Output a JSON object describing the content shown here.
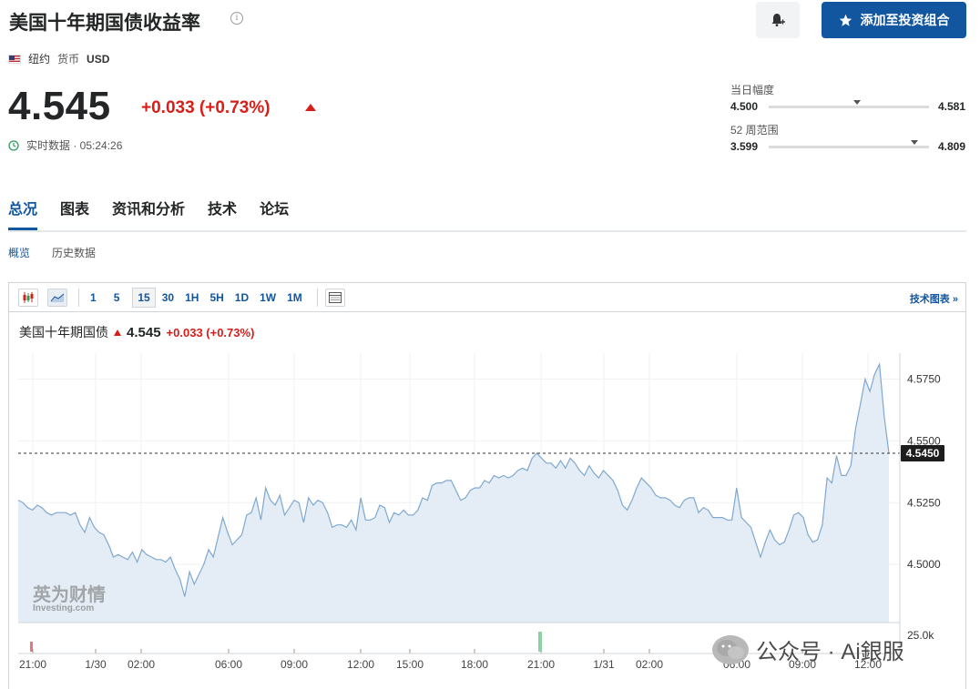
{
  "header": {
    "title": "美国十年期国债收益率",
    "info_icon": "info-icon",
    "add_button_label": "添加至投资组合",
    "bell_icon": "bell-plus-icon"
  },
  "meta": {
    "location": "纽约",
    "currency_label": "货币",
    "currency": "USD"
  },
  "quote": {
    "price": "4.545",
    "change": "+0.033 (+0.73%)",
    "status": "实时数据 · 05:24:26"
  },
  "ranges": {
    "day": {
      "label": "当日幅度",
      "low": "4.500",
      "high": "4.581",
      "marker": 0.55
    },
    "week52": {
      "label": "52 周范围",
      "low": "3.599",
      "high": "4.809",
      "marker": 0.91
    }
  },
  "tabs": [
    "总况",
    "图表",
    "资讯和分析",
    "技术",
    "论坛"
  ],
  "subtabs": [
    "概览",
    "历史数据"
  ],
  "toolbar": {
    "intervals": [
      "1",
      "5",
      "15",
      "30",
      "1H",
      "5H",
      "1D",
      "1W",
      "1M"
    ],
    "active_interval": "15",
    "tech_chart_label": "技术图表 »"
  },
  "legend": {
    "name": "美国十年期国债",
    "value": "4.545",
    "change": "+0.033 (+0.73%)"
  },
  "watermark": {
    "logo_cn": "英为财情",
    "logo_en": "Investing.com",
    "overlay": "公众号 · Ai銀服"
  },
  "colors": {
    "accent": "#1256a0",
    "down_red": "#d91e18",
    "line": "#7fa8cf",
    "area": "#e4edf5"
  },
  "chart_data": {
    "type": "area",
    "x_tick_labels": [
      "21:00",
      "1/30",
      "02:00",
      "06:00",
      "09:00",
      "12:00",
      "15:00",
      "18:00",
      "21:00",
      "1/31",
      "02:00",
      "06:00",
      "09:00",
      "12:00"
    ],
    "y_tick_labels": [
      "4.5750",
      "4.5500",
      "4.5250",
      "4.5000"
    ],
    "volume_label": "25.0k",
    "current_label": "4.5450",
    "current_value": 4.545,
    "ylim": [
      4.4765,
      4.5855
    ],
    "grid": true,
    "values": [
      4.526,
      4.525,
      4.523,
      4.522,
      4.524,
      4.523,
      4.521,
      4.52,
      4.521,
      4.521,
      4.521,
      4.52,
      4.521,
      4.516,
      4.513,
      4.519,
      4.515,
      4.513,
      4.512,
      4.508,
      4.503,
      4.504,
      4.503,
      4.502,
      4.505,
      4.501,
      4.506,
      4.504,
      4.503,
      4.502,
      4.502,
      4.501,
      4.503,
      4.498,
      4.494,
      4.487,
      4.497,
      4.492,
      4.496,
      4.5,
      4.506,
      4.503,
      4.511,
      4.519,
      4.513,
      4.508,
      4.51,
      4.512,
      4.52,
      4.521,
      4.527,
      4.518,
      4.531,
      4.526,
      4.524,
      4.528,
      4.52,
      4.523,
      4.526,
      4.525,
      4.517,
      4.527,
      4.524,
      4.526,
      4.525,
      4.521,
      4.515,
      4.516,
      4.516,
      4.515,
      4.518,
      4.514,
      4.527,
      4.518,
      4.518,
      4.519,
      4.524,
      4.523,
      4.517,
      4.521,
      4.52,
      4.522,
      4.52,
      4.52,
      4.522,
      4.527,
      4.526,
      4.532,
      4.533,
      4.533,
      4.534,
      4.534,
      4.53,
      4.526,
      4.527,
      4.53,
      4.531,
      4.531,
      4.534,
      4.533,
      4.536,
      4.535,
      4.536,
      4.535,
      4.536,
      4.538,
      4.539,
      4.538,
      4.543,
      4.545,
      4.543,
      4.541,
      4.541,
      4.539,
      4.542,
      4.539,
      4.543,
      4.541,
      4.538,
      4.536,
      4.54,
      4.537,
      4.535,
      4.538,
      4.536,
      4.534,
      4.53,
      4.524,
      4.522,
      4.526,
      4.531,
      4.535,
      4.533,
      4.531,
      4.528,
      4.527,
      4.527,
      4.526,
      4.524,
      4.523,
      4.526,
      4.527,
      4.527,
      4.521,
      4.523,
      4.522,
      4.519,
      4.519,
      4.519,
      4.518,
      4.518,
      4.531,
      4.519,
      4.517,
      4.515,
      4.509,
      4.503,
      4.509,
      4.514,
      4.51,
      4.508,
      4.509,
      4.514,
      4.52,
      4.521,
      4.519,
      4.512,
      4.509,
      4.51,
      4.516,
      4.535,
      4.533,
      4.544,
      4.536,
      4.536,
      4.54,
      4.555,
      4.565,
      4.575,
      4.57,
      4.577,
      4.581,
      4.56,
      4.545
    ]
  }
}
